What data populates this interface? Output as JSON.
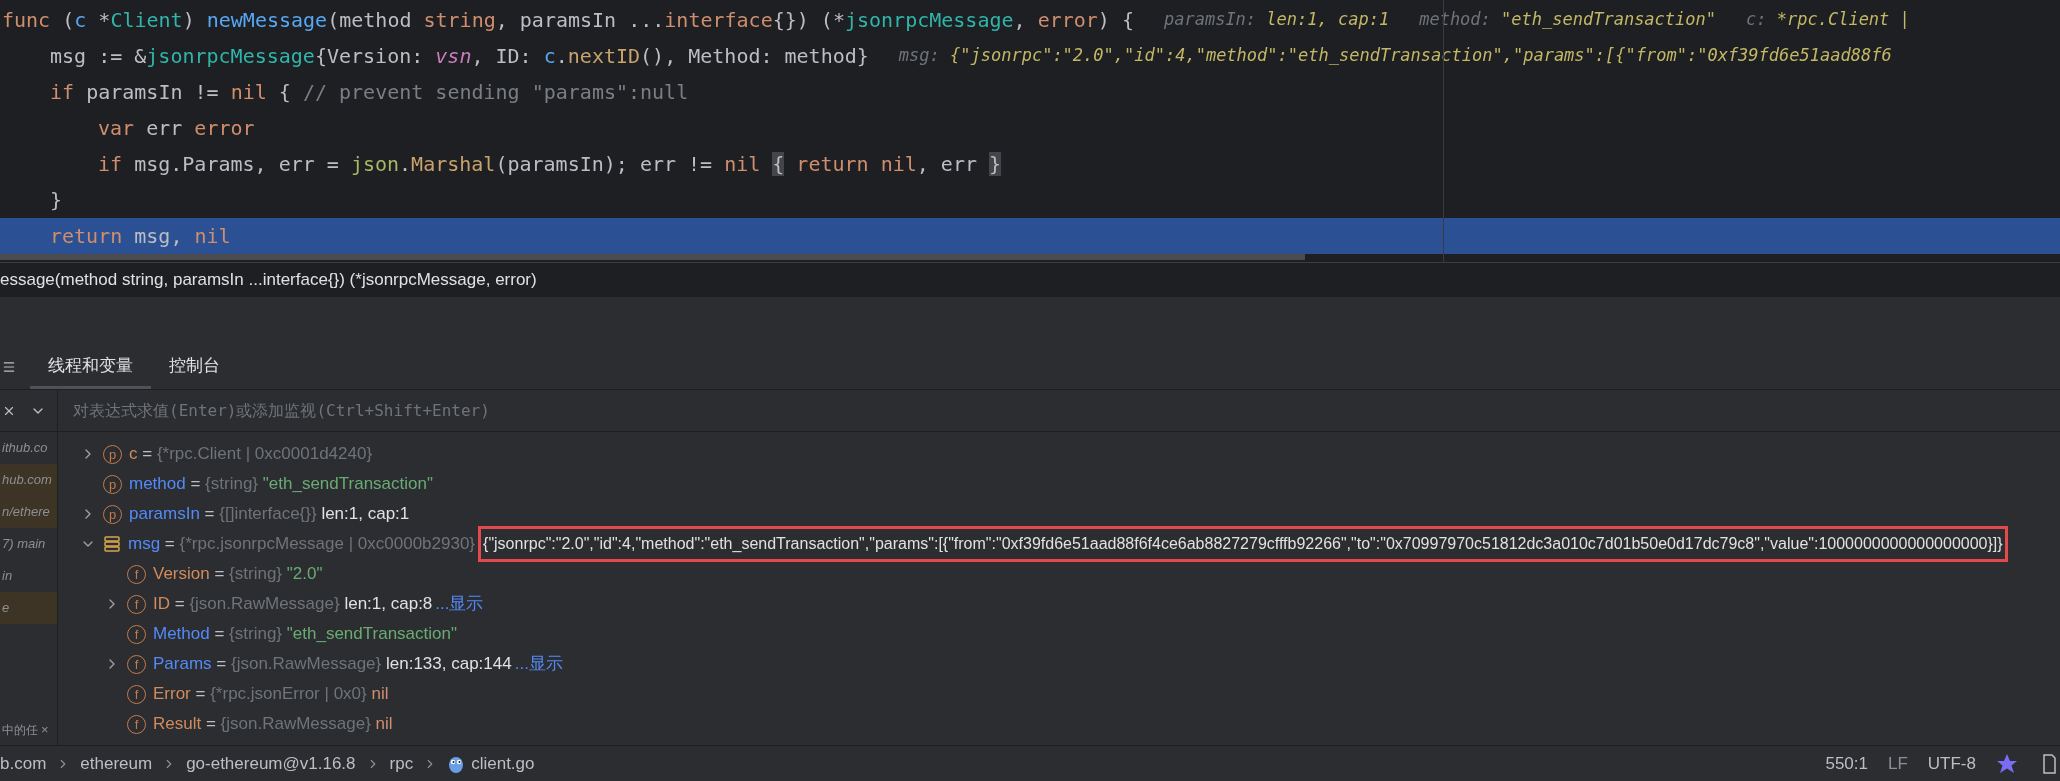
{
  "editor": {
    "lines": [
      {
        "current": false,
        "tokens": [
          {
            "kind": "kw",
            "text": "func"
          },
          {
            "kind": "plain",
            "text": " ("
          },
          {
            "kind": "param",
            "text": "c"
          },
          {
            "kind": "plain",
            "text": " *"
          },
          {
            "kind": "type",
            "text": "Client"
          },
          {
            "kind": "plain",
            "text": ") "
          },
          {
            "kind": "fn",
            "text": "newMessage"
          },
          {
            "kind": "plain",
            "text": "(method "
          },
          {
            "kind": "kw",
            "text": "string"
          },
          {
            "kind": "plain",
            "text": ", paramsIn ..."
          },
          {
            "kind": "kw",
            "text": "interface"
          },
          {
            "kind": "plain",
            "text": "{}) (*"
          },
          {
            "kind": "type",
            "text": "jsonrpcMessage"
          },
          {
            "kind": "plain",
            "text": ", "
          },
          {
            "kind": "kw",
            "text": "error"
          },
          {
            "kind": "plain",
            "text": ") {"
          }
        ],
        "hints": [
          {
            "label": "paramsIn:",
            "value": "len:1, cap:1"
          },
          {
            "label": "method:",
            "value": "\"eth_sendTransaction\""
          },
          {
            "label": "c:",
            "value": "*rpc.Client |"
          }
        ],
        "children": [
          {
            "current": false,
            "tokens": [
              {
                "kind": "plain",
                "text": "msg := &"
              },
              {
                "kind": "type",
                "text": "jsonrpcMessage"
              },
              {
                "kind": "plain",
                "text": "{Version: "
              },
              {
                "kind": "const",
                "text": "vsn"
              },
              {
                "kind": "plain",
                "text": ", ID: "
              },
              {
                "kind": "param",
                "text": "c"
              },
              {
                "kind": "plain",
                "text": "."
              },
              {
                "kind": "call",
                "text": "nextID"
              },
              {
                "kind": "plain",
                "text": "(), Method: method}"
              }
            ],
            "hints": [
              {
                "label": "msg:",
                "value": "{\"jsonrpc\":\"2.0\",\"id\":4,\"method\":\"eth_sendTransaction\",\"params\":[{\"from\":\"0xf39fd6e51aad88f6"
              }
            ]
          },
          {
            "current": false,
            "tokens": [
              {
                "kind": "kw",
                "text": "if"
              },
              {
                "kind": "plain",
                "text": " paramsIn != "
              },
              {
                "kind": "kw",
                "text": "nil"
              },
              {
                "kind": "plain",
                "text": " { "
              },
              {
                "kind": "comment",
                "text": "// prevent sending \"params\":null"
              }
            ],
            "children": [
              {
                "current": false,
                "tokens": [
                  {
                    "kind": "kw",
                    "text": "var"
                  },
                  {
                    "kind": "plain",
                    "text": " err "
                  },
                  {
                    "kind": "kw",
                    "text": "error"
                  }
                ]
              },
              {
                "current": false,
                "tokens": [
                  {
                    "kind": "kw",
                    "text": "if"
                  },
                  {
                    "kind": "plain",
                    "text": " msg.Params, err = "
                  },
                  {
                    "kind": "pkg",
                    "text": "json"
                  },
                  {
                    "kind": "plain",
                    "text": "."
                  },
                  {
                    "kind": "call",
                    "text": "Marshal"
                  },
                  {
                    "kind": "plain",
                    "text": "(paramsIn); err != "
                  },
                  {
                    "kind": "kw",
                    "text": "nil"
                  },
                  {
                    "kind": "brace",
                    "text": "{"
                  },
                  {
                    "kind": "kw",
                    "text": "return nil"
                  },
                  {
                    "kind": "plain",
                    "text": ", err"
                  },
                  {
                    "kind": "brace",
                    "text": "}"
                  }
                ]
              }
            ]
          },
          {
            "current": false,
            "tokens": [
              {
                "kind": "plain",
                "text": "}"
              }
            ]
          },
          {
            "current": true,
            "tokens": [
              {
                "kind": "kw",
                "text": "return"
              },
              {
                "kind": "plain",
                "text": " msg, "
              },
              {
                "kind": "kw",
                "text": "nil"
              }
            ]
          }
        ]
      }
    ]
  },
  "signature": "essage(method string, paramsIn ...interface{}) (*jsonrpcMessage, error)",
  "debug_tabs": [
    {
      "label": "线程和变量",
      "selected": true
    },
    {
      "label": "控制台",
      "selected": false
    }
  ],
  "eval_field": {
    "placeholder": "对表达式求值(Enter)或添加监视(Ctrl+Shift+Enter)"
  },
  "frames": [
    {
      "text": "ithub.co",
      "highlighted": false
    },
    {
      "text": "hub.com",
      "highlighted": true
    },
    {
      "text": "n/ethere",
      "highlighted": true
    },
    {
      "text": "7) main",
      "highlighted": false
    },
    {
      "text": "in",
      "highlighted": false
    },
    {
      "text": "e",
      "highlighted": true
    }
  ],
  "frames_tab": {
    "label": "中的任",
    "close": "×"
  },
  "variables": {
    "assign": "=",
    "items": [
      {
        "name": "c",
        "kind": "param",
        "badge": "p",
        "changed": false,
        "expanded": false,
        "type": "{*rpc.Client | 0xc0001d4240}"
      },
      {
        "name": "method",
        "kind": "param",
        "badge": "p",
        "changed": true,
        "type": "{string}",
        "value": "\"eth_sendTransaction\"",
        "color": "#6aab73"
      },
      {
        "name": "paramsIn",
        "kind": "param",
        "badge": "p",
        "changed": true,
        "expanded": false,
        "type": "{[]interface{}}",
        "value": "len:1, cap:1",
        "color": "#dfe1e5"
      },
      {
        "name": "msg",
        "kind": "struct",
        "changed": true,
        "expanded": true,
        "type": "{*rpc.jsonrpcMessage | 0xc0000b2930}",
        "annotated_value": "{\"jsonrpc\":\"2.0\",\"id\":4,\"method\":\"eth_sendTransaction\",\"params\":[{\"from\":\"0xf39fd6e51aad88f6f4ce6ab8827279cfffb92266\",\"to\":\"0x70997970c51812dc3a010c7d01b50e0d17dc79c8\",\"value\":1000000000000000000}]}",
        "children": [
          {
            "name": "Version",
            "kind": "field",
            "badge": "f",
            "changed": false,
            "type": "{string}",
            "value": "\"2.0\"",
            "color": "#6aab73"
          },
          {
            "name": "ID",
            "kind": "field",
            "badge": "f",
            "changed": false,
            "expanded": false,
            "type": "{json.RawMessage}",
            "value": "len:1, cap:8",
            "color": "#dfe1e5",
            "link": "...显示"
          },
          {
            "name": "Method",
            "kind": "field",
            "badge": "f",
            "changed": true,
            "type": "{string}",
            "value": "\"eth_sendTransaction\"",
            "color": "#6aab73"
          },
          {
            "name": "Params",
            "kind": "field",
            "badge": "f",
            "changed": true,
            "expanded": false,
            "type": "{json.RawMessage}",
            "value": "len:133, cap:144",
            "color": "#dfe1e5",
            "link": "...显示"
          },
          {
            "name": "Error",
            "kind": "field",
            "badge": "f",
            "changed": false,
            "type": "{*rpc.jsonError | 0x0}",
            "value": "nil",
            "color": "#cf8e6d"
          },
          {
            "name": "Result",
            "kind": "field",
            "badge": "f",
            "changed": false,
            "type": "{json.RawMessage}",
            "value": "nil",
            "color": "#cf8e6d"
          }
        ]
      }
    ]
  },
  "breadcrumbs": [
    {
      "text": "b.com",
      "kind": "folder"
    },
    {
      "text": "ethereum",
      "kind": "folder"
    },
    {
      "text": "go-ethereum@v1.16.8",
      "kind": "folder"
    },
    {
      "text": "rpc",
      "kind": "folder"
    },
    {
      "text": "client.go",
      "kind": "go_file"
    }
  ],
  "status_bar": {
    "position": "550:1",
    "line_separator": "LF",
    "encoding": "UTF-8"
  }
}
